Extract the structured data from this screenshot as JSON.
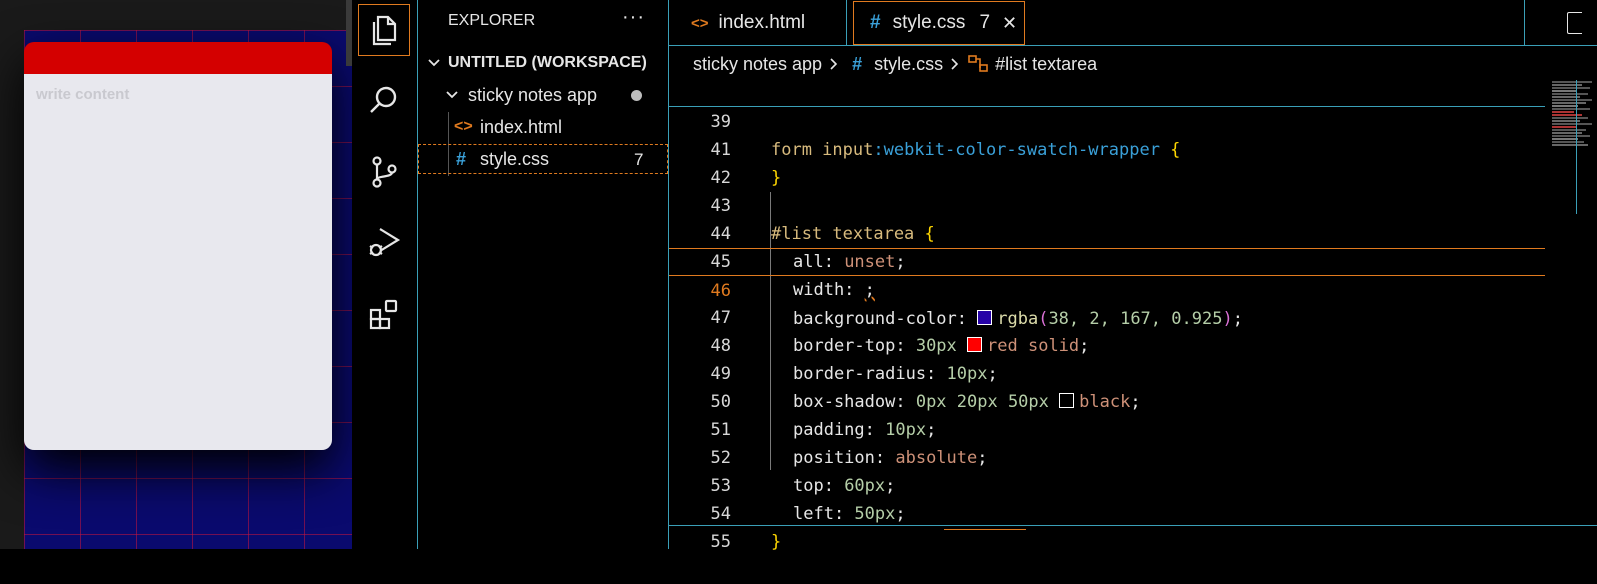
{
  "preview": {
    "note_placeholder": "write content",
    "colors": {
      "note_header": "#d40000",
      "note_body": "#e8e8ee",
      "canvas": "#0a0a6e"
    }
  },
  "activity_bar": {
    "items": [
      "explorer-icon",
      "search-icon",
      "source-control-icon",
      "run-debug-icon",
      "extensions-icon"
    ]
  },
  "explorer": {
    "title": "EXPLORER",
    "more": "···",
    "workspace": "UNTITLED (WORKSPACE)",
    "folder": "sticky notes app",
    "files": [
      {
        "icon": "<>",
        "name": "index.html",
        "badge": ""
      },
      {
        "icon": "#",
        "name": "style.css",
        "badge": "7"
      }
    ]
  },
  "tabs": [
    {
      "icon": "<>",
      "label": "index.html",
      "badge": ""
    },
    {
      "icon": "#",
      "label": "style.css",
      "badge": "7",
      "close": "✕"
    }
  ],
  "breadcrumb": {
    "folder": "sticky notes app",
    "file_icon": "#",
    "file": "style.css",
    "symbol": "#list textarea"
  },
  "editor": {
    "lines": [
      {
        "n": "39",
        "sticky": true
      },
      {
        "n": "41"
      },
      {
        "n": "42"
      },
      {
        "n": "43"
      },
      {
        "n": "44"
      },
      {
        "n": "45"
      },
      {
        "n": "46",
        "current": true
      },
      {
        "n": "47"
      },
      {
        "n": "48"
      },
      {
        "n": "49"
      },
      {
        "n": "50"
      },
      {
        "n": "51"
      },
      {
        "n": "52"
      },
      {
        "n": "53"
      },
      {
        "n": "54"
      },
      {
        "n": "55"
      }
    ],
    "code": {
      "l39_sel": "form input",
      "l39_pseudo": ":webkit-color-swatch-wrapper",
      "l39_brace": " {",
      "l41": "}",
      "l43_sel": "#list textarea",
      "l43_brace": " {",
      "l44_prop": "all: ",
      "l44_val": "unset",
      "l45_prop": "width: ",
      "l45_val": ";",
      "l46_prop": "background-color: ",
      "l46_fn": "rgba",
      "l46_open": "(",
      "l46_args": "38, 2, 167, 0.925",
      "l46_close": ")",
      "l47_prop": "border-top: ",
      "l47_num": "30px",
      "l47_val": "red solid",
      "l48_prop": "border-radius: ",
      "l48_num": "10px",
      "l49_prop": "box-shadow: ",
      "l49_num": "0px 20px 50px",
      "l49_val": "black",
      "l50_prop": "padding: ",
      "l50_num": "10px",
      "l51_prop": "position: ",
      "l51_val": "absolute",
      "l52_prop": "top: ",
      "l52_num": "60px",
      "l53_prop": "left: ",
      "l53_num": "50px",
      "l54": "}",
      "semi": ";"
    },
    "swatch_colors": {
      "rgba": "#2602a7",
      "red": "#ff0000",
      "black": "#000000"
    }
  },
  "colors": {
    "accent": "#e07a1f",
    "border": "#3a9fb8"
  }
}
